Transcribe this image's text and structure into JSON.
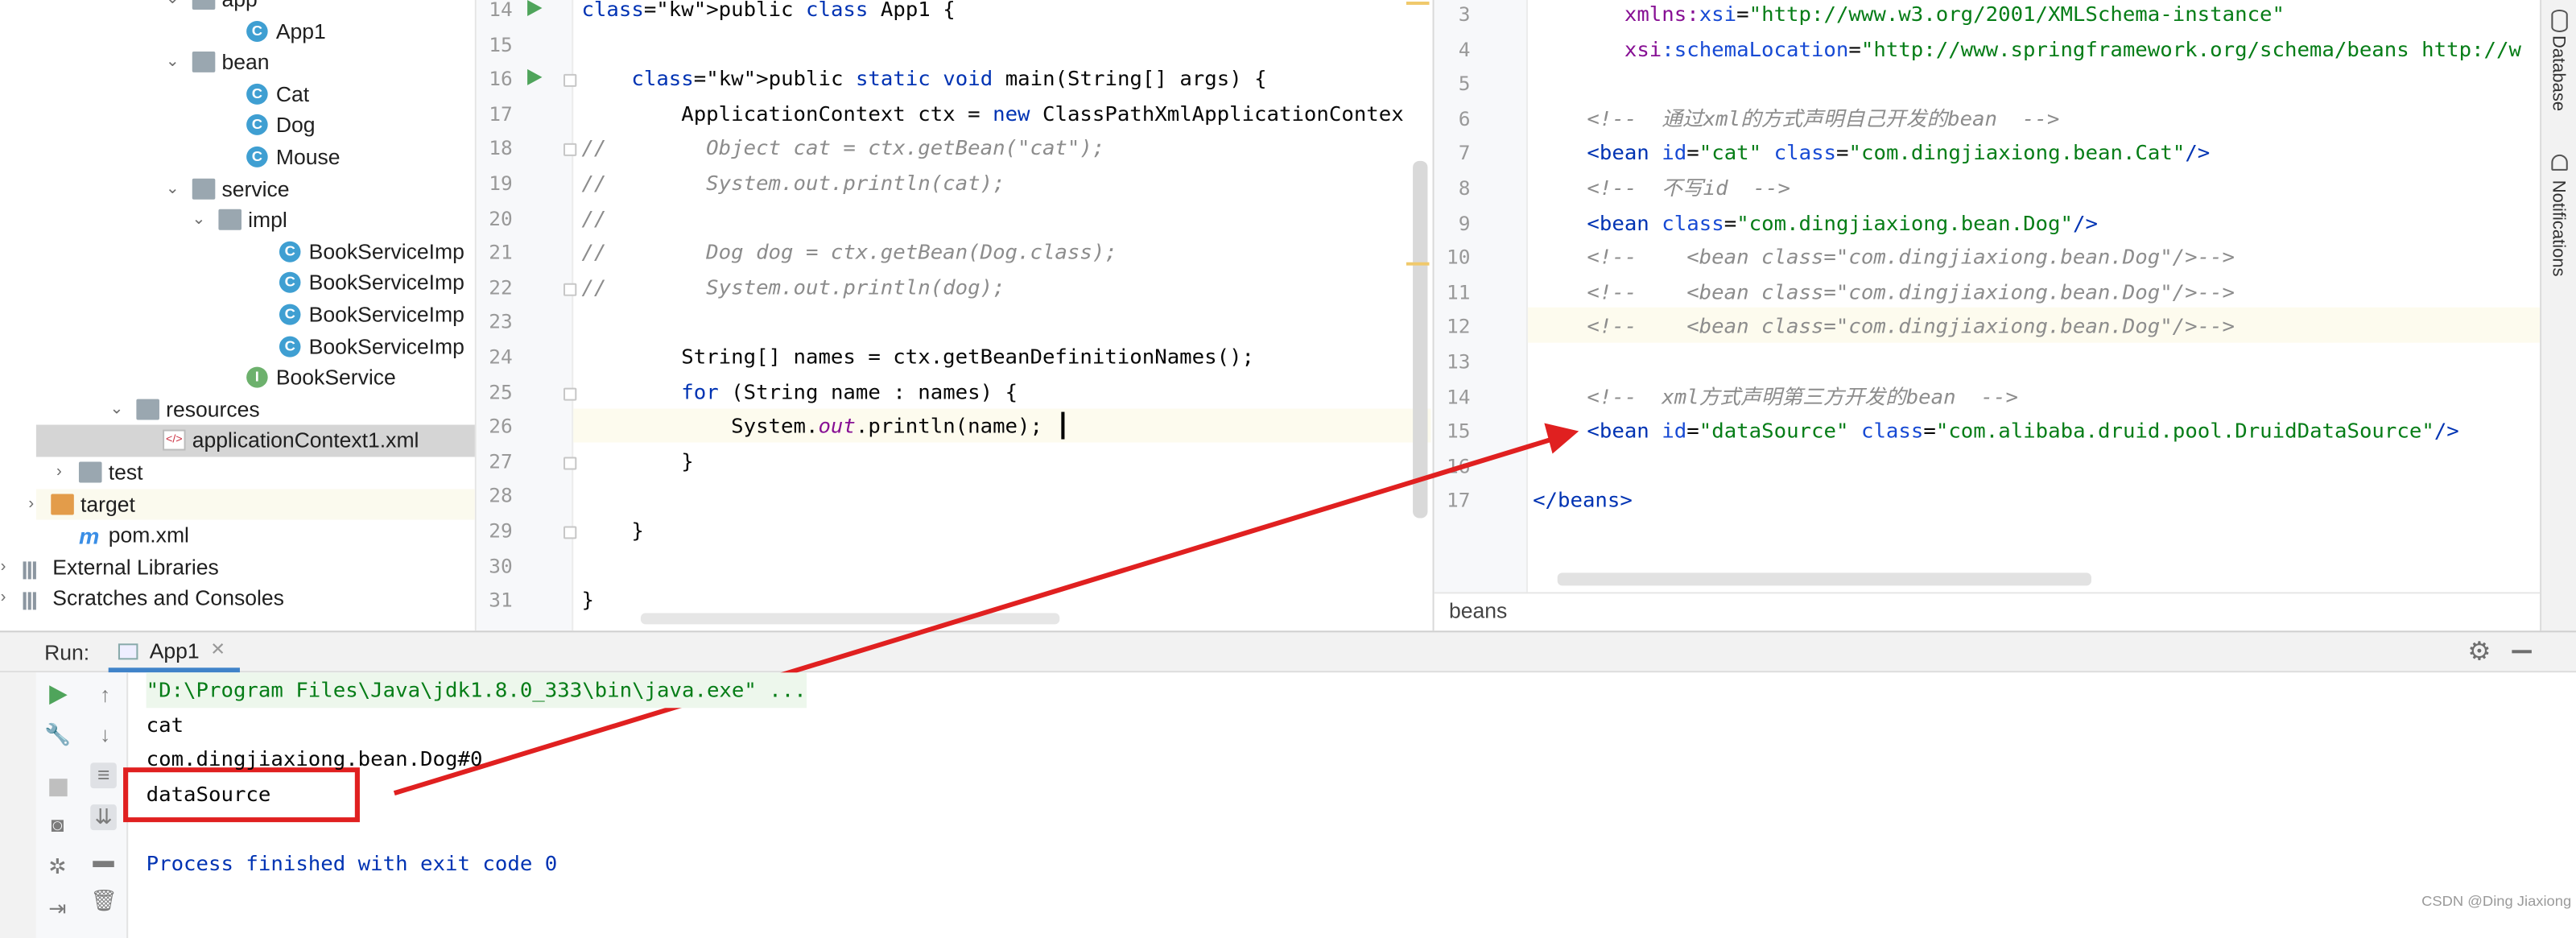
{
  "project_tree": {
    "items": [
      {
        "label": "app",
        "icon": "folder-icon",
        "expanded": true
      },
      {
        "label": "App1",
        "icon": "class-icon"
      },
      {
        "label": "bean",
        "icon": "folder-icon",
        "expanded": true
      },
      {
        "label": "Cat",
        "icon": "class-icon"
      },
      {
        "label": "Dog",
        "icon": "class-icon"
      },
      {
        "label": "Mouse",
        "icon": "class-icon"
      },
      {
        "label": "service",
        "icon": "folder-icon",
        "expanded": true
      },
      {
        "label": "impl",
        "icon": "folder-icon",
        "expanded": true
      },
      {
        "label": "BookServiceImp",
        "icon": "class-icon"
      },
      {
        "label": "BookServiceImp",
        "icon": "class-icon"
      },
      {
        "label": "BookServiceImp",
        "icon": "class-icon"
      },
      {
        "label": "BookServiceImp",
        "icon": "class-icon"
      },
      {
        "label": "BookService",
        "icon": "interface-icon"
      },
      {
        "label": "resources",
        "icon": "resources-folder-icon",
        "expanded": true
      },
      {
        "label": "applicationContext1.xml",
        "icon": "xml-file-icon",
        "selected": true
      },
      {
        "label": "test",
        "icon": "folder-icon",
        "expanded": false
      },
      {
        "label": "target",
        "icon": "folder-icon",
        "expanded": false
      },
      {
        "label": "pom.xml",
        "icon": "maven-icon"
      },
      {
        "label": "External Libraries",
        "icon": "library-icon",
        "expanded": false
      },
      {
        "label": "Scratches and Consoles",
        "icon": "scratches-icon",
        "expanded": false
      }
    ]
  },
  "java_editor": {
    "lines": [
      {
        "n": "14",
        "text": "public class App1 {"
      },
      {
        "n": "15",
        "text": ""
      },
      {
        "n": "16",
        "text": "    public static void main(String[] args) {"
      },
      {
        "n": "17",
        "text": "        ApplicationContext ctx = new ClassPathXmlApplicationContex"
      },
      {
        "n": "18",
        "text": "//        Object cat = ctx.getBean(\"cat\");"
      },
      {
        "n": "19",
        "text": "//        System.out.println(cat);"
      },
      {
        "n": "20",
        "text": "//"
      },
      {
        "n": "21",
        "text": "//        Dog dog = ctx.getBean(Dog.class);"
      },
      {
        "n": "22",
        "text": "//        System.out.println(dog);"
      },
      {
        "n": "23",
        "text": ""
      },
      {
        "n": "24",
        "text": "        String[] names = ctx.getBeanDefinitionNames();"
      },
      {
        "n": "25",
        "text": "        for (String name : names) {"
      },
      {
        "n": "26",
        "text": "            System.out.println(name);"
      },
      {
        "n": "27",
        "text": "        }"
      },
      {
        "n": "28",
        "text": ""
      },
      {
        "n": "29",
        "text": "    }"
      },
      {
        "n": "30",
        "text": ""
      },
      {
        "n": "31",
        "text": "}"
      }
    ]
  },
  "xml_editor": {
    "lines": [
      {
        "n": "3",
        "text": ""
      },
      {
        "n": "4",
        "text": ""
      },
      {
        "n": "5",
        "text": ""
      },
      {
        "n": "6",
        "text": ""
      },
      {
        "n": "7",
        "text": ""
      },
      {
        "n": "8",
        "text": ""
      },
      {
        "n": "9",
        "text": ""
      },
      {
        "n": "10",
        "text": ""
      },
      {
        "n": "11",
        "text": ""
      },
      {
        "n": "12",
        "text": ""
      },
      {
        "n": "13",
        "text": ""
      },
      {
        "n": "14",
        "text": ""
      },
      {
        "n": "15",
        "text": ""
      },
      {
        "n": "16",
        "text": ""
      },
      {
        "n": "17",
        "text": ""
      }
    ],
    "l3_attr": "xmlns:xsi",
    "l3_val": "\"http://www.w3.org/2001/XMLSchema-instance\"",
    "l4_attr": "xsi:schemaLocation",
    "l4_val": "\"http://www.springframework.org/schema/beans http://w",
    "l6": "<!--  通过xml的方式声明自己开发的bean  -->",
    "l7_id": "\"cat\"",
    "l7_class": "\"com.dingjiaxiong.bean.Cat\"",
    "l8": "<!--  不写id  -->",
    "l9_class": "\"com.dingjiaxiong.bean.Dog\"",
    "l10": "<!--    <bean class=\"com.dingjiaxiong.bean.Dog\"/>-->",
    "l11": "<!--    <bean class=\"com.dingjiaxiong.bean.Dog\"/>-->",
    "l12": "<!--    <bean class=\"com.dingjiaxiong.bean.Dog\"/>-->",
    "l14": "<!--  xml方式声明第三方开发的bean  -->",
    "l15_id": "\"dataSource\"",
    "l15_class": "\"com.alibaba.druid.pool.DruidDataSource\"",
    "l17": "</beans>",
    "breadcrumb": "beans"
  },
  "run_panel": {
    "label": "Run:",
    "tab": "App1",
    "output": [
      "\"D:\\Program Files\\Java\\jdk1.8.0_333\\bin\\java.exe\" ...",
      "cat",
      "com.dingjiaxiong.bean.Dog#0",
      "dataSource",
      "",
      "Process finished with exit code 0"
    ]
  },
  "right_strip": {
    "database": "Database",
    "notifications": "Notifications"
  },
  "watermark": "CSDN @Ding Jiaxiong",
  "colors": {
    "annotation": "#e02020",
    "run_green": "#4fa45b"
  }
}
